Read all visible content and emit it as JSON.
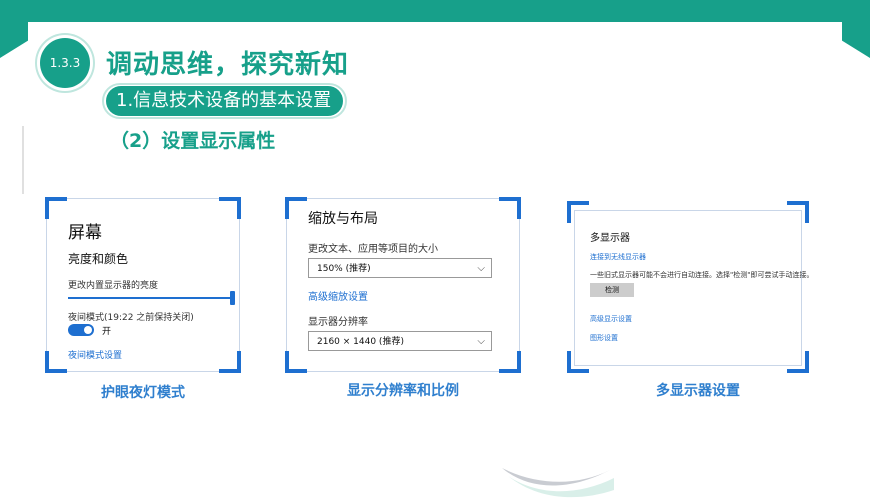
{
  "header": {
    "section_number": "1.3.3",
    "title": "调动思维，探究新知",
    "subtitle": "1.信息技术设备的基本设置",
    "heading": "（2）设置显示属性"
  },
  "panels": [
    {
      "caption": "护眼夜灯模式",
      "title": "屏幕",
      "subtitle": "亮度和颜色",
      "brightness_label": "更改内置显示器的亮度",
      "brightness_level": 1.0,
      "night_mode_label": "夜间模式(19:22 之前保持关闭)",
      "toggle_state": "开",
      "link": "夜间模式设置"
    },
    {
      "caption": "显示分辨率和比例",
      "title": "缩放与布局",
      "scale_label": "更改文本、应用等项目的大小",
      "scale_value": "150% (推荐)",
      "advanced_link": "高级缩放设置",
      "resolution_label": "显示器分辨率",
      "resolution_value": "2160 × 1440 (推荐)"
    },
    {
      "caption": "多显示器设置",
      "title": "多显示器",
      "connect_link": "连接到无线显示器",
      "info_text": "一些旧式显示器可能不会进行自动连接。选择\"检测\"即可尝试手动连接。",
      "detect_button": "检测",
      "advanced_link": "高级显示设置",
      "graphics_link": "图形设置"
    }
  ],
  "colors": {
    "teal": "#17a08a",
    "blue": "#1e6fd0",
    "caption_blue": "#2f7fce"
  }
}
